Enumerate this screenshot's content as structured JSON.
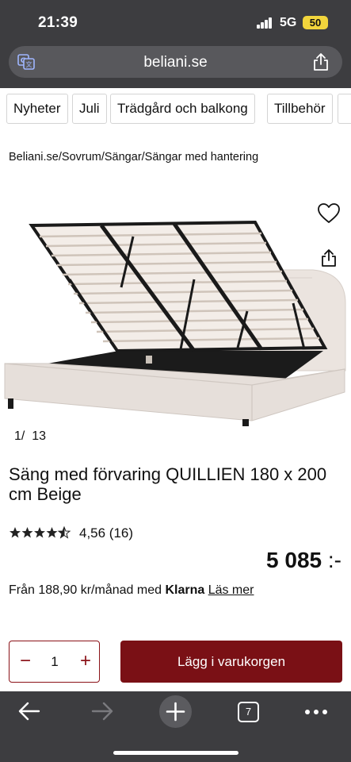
{
  "status_bar": {
    "time": "21:39",
    "network": "5G",
    "battery": "50"
  },
  "browser": {
    "url": "beliani.se",
    "open_tabs": "7"
  },
  "categories": [
    "Nyheter",
    "Juli",
    "Trädgård och balkong",
    "Tillbehör"
  ],
  "breadcrumb": "Beliani.se/Sovrum/Sängar/Sängar med hantering",
  "gallery": {
    "current": "1",
    "separator": "/",
    "total": "13"
  },
  "product": {
    "title": "Säng med förvaring QUILLIEN 180 x 200 cm Beige",
    "rating_text": "4,56 (16)",
    "rating_value": 4.56,
    "price": "5 085",
    "price_suffix": ":-",
    "installment_prefix": "Från 188,90 kr/månad med ",
    "installment_provider": "Klarna",
    "installment_link": "Läs mer"
  },
  "cart": {
    "quantity": "1",
    "minus_label": "−",
    "plus_label": "+",
    "add_label": "Lägg i varukorgen"
  },
  "colors": {
    "accent": "#7a1015",
    "chrome": "#3d3d40",
    "bed_fabric": "#e6dfda"
  },
  "icons": [
    "translate-icon",
    "share-icon",
    "heart-icon",
    "star-icon",
    "back-arrow-icon",
    "forward-arrow-icon",
    "plus-icon",
    "tabs-icon",
    "more-icon"
  ]
}
